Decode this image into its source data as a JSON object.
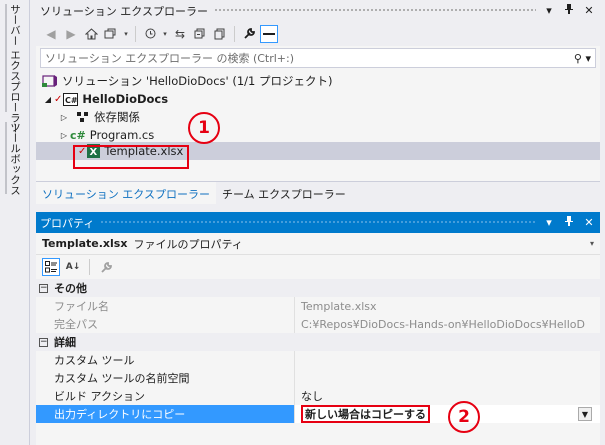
{
  "side_strip": {
    "server_explorer": "サーバー エクスプローラー",
    "toolbox": "ツールボックス"
  },
  "solution_explorer": {
    "title": "ソリューション エクスプローラー",
    "title_buttons": [
      "▾",
      "ᴾ",
      "✕"
    ],
    "toolbar_icons": [
      "back-icon",
      "forward-icon",
      "home-icon",
      "switch-views-icon",
      "pending-changes-icon",
      "sync-icon",
      "collapse-all-icon",
      "show-all-files-icon",
      "properties-icon",
      "preview-icon"
    ],
    "search_placeholder": "ソリューション エクスプローラー の検索 (Ctrl+:)",
    "tree": [
      {
        "label": "ソリューション 'HelloDioDocs' (1/1 プロジェクト)",
        "icon": "solution-icon"
      },
      {
        "label": "HelloDioDocs",
        "icon": "csharp-project-icon"
      },
      {
        "label": "依存関係",
        "icon": "dependencies-icon"
      },
      {
        "label": "Program.cs",
        "icon": "csharp-file-icon"
      },
      {
        "label": "Template.xlsx",
        "icon": "excel-file-icon"
      }
    ],
    "tabs": [
      "ソリューション エクスプローラー",
      "チーム エクスプローラー"
    ]
  },
  "properties": {
    "title": "プロパティ",
    "title_buttons": [
      "▾",
      "ᴾ",
      "✕"
    ],
    "object_name": "Template.xlsx",
    "object_type": "ファイルのプロパティ",
    "categories": [
      {
        "name": "その他",
        "rows": [
          {
            "name": "ファイル名",
            "value": "Template.xlsx"
          },
          {
            "name": "完全パス",
            "value": "C:¥Repos¥DioDocs-Hands-on¥HelloDioDocs¥HelloD"
          }
        ]
      },
      {
        "name": "詳細",
        "rows": [
          {
            "name": "カスタム ツール",
            "value": ""
          },
          {
            "name": "カスタム ツールの名前空間",
            "value": ""
          },
          {
            "name": "ビルド アクション",
            "value": "なし"
          },
          {
            "name": "出力ディレクトリにコピー",
            "value": "新しい場合はコピーする"
          }
        ]
      }
    ]
  },
  "annotations": {
    "marker_1": "1",
    "marker_2": "2",
    "color": "#e60012"
  },
  "colors": {
    "accent": "#007acc",
    "selection": "#3399ff"
  }
}
